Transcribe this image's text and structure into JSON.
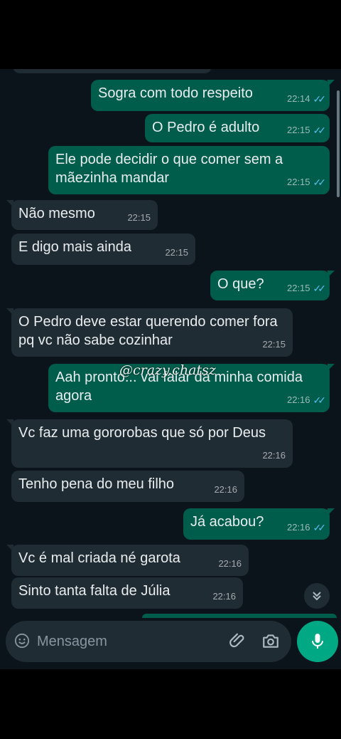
{
  "messages": [
    {
      "dir": "out",
      "text": "Sogra com todo respeito",
      "time": "22:14",
      "read": true
    },
    {
      "dir": "out",
      "text": "O Pedro é adulto",
      "time": "22:15",
      "read": true
    },
    {
      "dir": "out",
      "text": "Ele pode decidir o que comer sem a mãezinha mandar",
      "time": "22:15",
      "read": true
    },
    {
      "dir": "in",
      "text": "Não mesmo",
      "time": "22:15"
    },
    {
      "dir": "in",
      "text": "E digo mais ainda",
      "time": "22:15"
    },
    {
      "dir": "out",
      "text": "O que?",
      "time": "22:15",
      "read": true
    },
    {
      "dir": "in",
      "text": "O Pedro deve estar querendo comer fora pq vc não sabe cozinhar",
      "time": "22:15"
    },
    {
      "dir": "out",
      "text": "Aah pronto... vai falar da minha comida agora",
      "time": "22:16",
      "read": true
    },
    {
      "dir": "in",
      "text": "Vc faz uma gororobas que só por Deus",
      "time": "22:16"
    },
    {
      "dir": "in",
      "text": "Tenho pena do meu filho",
      "time": "22:16"
    },
    {
      "dir": "out",
      "text": "Já acabou?",
      "time": "22:16",
      "read": true
    },
    {
      "dir": "in",
      "text": "Vc é mal criada né garota",
      "time": "22:16"
    },
    {
      "dir": "in",
      "text": "Sinto tanta falta de Júlia",
      "time": "22:16"
    }
  ],
  "watermark": "@crazy.chatsz",
  "composer": {
    "placeholder": "Mensagem"
  },
  "colors": {
    "incoming": "#202c33",
    "outgoing": "#005c4b",
    "accent": "#00a884",
    "read_ticks": "#53bdeb",
    "background": "#0b141a"
  },
  "icons": [
    "emoji-icon",
    "attach-icon",
    "camera-icon",
    "mic-icon",
    "chevron-down-icon",
    "double-check-icon"
  ]
}
